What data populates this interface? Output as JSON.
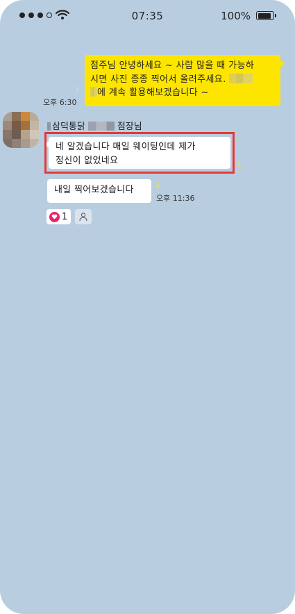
{
  "status_bar": {
    "time": "07:35",
    "battery": "100%"
  },
  "messages": {
    "outgoing": {
      "line1": "점주님 안녕하세요 ~ 사람 많을 때 가능하",
      "line2": "시면 사진 종종 찍어서 올려주세요.",
      "line3": "에 계속 활용해보겠습니다 ~",
      "read_count": "1",
      "time": "오후 6:30"
    },
    "sender": {
      "name_prefix": "삼덕통닭",
      "name_suffix": "점장님"
    },
    "incoming": [
      {
        "line1": "네 알겠습니다 매일 웨이팅인데 제가",
        "line2": "정신이 없었네요",
        "read_count": "1"
      },
      {
        "text": "내일 찍어보겠습니다",
        "read_count": "1",
        "time": "오후 11:36"
      }
    ],
    "reactions": {
      "like_count": "1"
    }
  },
  "colors": {
    "chat_background": "#b9cde0",
    "outgoing_bubble": "#fee500",
    "incoming_bubble": "#ffffff",
    "highlight_box": "#e53935",
    "heart": "#e8226b"
  }
}
